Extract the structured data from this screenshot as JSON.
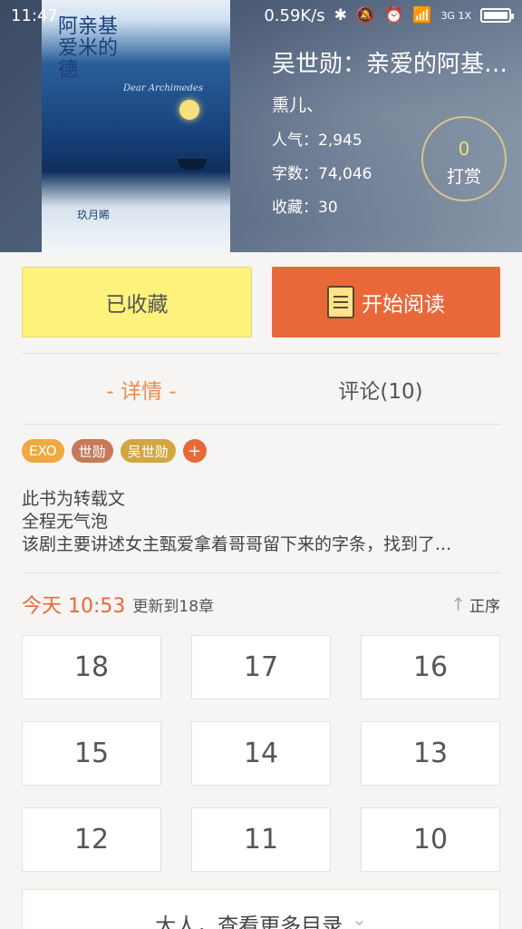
{
  "status_bar": {
    "time": "11:47",
    "speed": "0.59K/s",
    "network": "3G 1X"
  },
  "book": {
    "title": "吴世勋：亲爱的阿基米德",
    "author": "熏儿、",
    "popularity": "人气：2,945",
    "word_count": "字数：74,046",
    "favorites": "收藏：30",
    "tip_count": "0",
    "tip_label": "打赏",
    "cover": {
      "title": "阿亲基爱米的德",
      "subtitle": "Dear Archimedes",
      "badge": "玖月晞"
    }
  },
  "actions": {
    "collected_label": "已收藏",
    "read_label": "开始阅读"
  },
  "tabs": [
    {
      "label": "- 详情 -",
      "active": true
    },
    {
      "label": "评论(10)",
      "active": false
    }
  ],
  "tags": [
    {
      "label": "EXO",
      "color": "#f0a840"
    },
    {
      "label": "世勋",
      "color": "#c57a5a"
    },
    {
      "label": "吴世勋",
      "color": "#d2a640"
    }
  ],
  "tag_add_label": "+",
  "description": [
    "此书为转载文",
    "全程无气泡",
    "该剧主要讲述女主甄爱拿着哥哥留下来的字条，找到了..."
  ],
  "update": {
    "time": "今天 10:53",
    "text": "更新到18章",
    "sort_label": "正序"
  },
  "chapters": [
    "18",
    "17",
    "16",
    "15",
    "14",
    "13",
    "12",
    "11",
    "10"
  ],
  "more_label": "大人，查看更多目录"
}
